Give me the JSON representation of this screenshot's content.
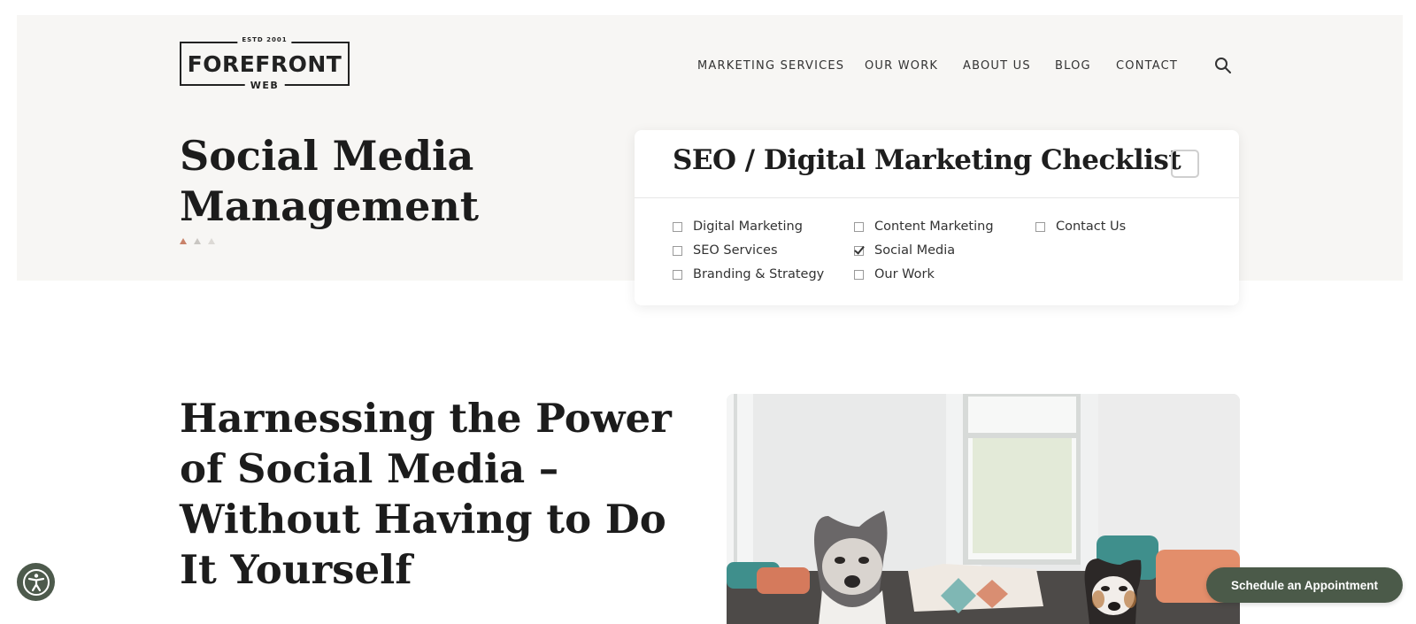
{
  "logo": {
    "tag": "ESTD 2001",
    "name": "FOREFRONT",
    "sub": "WEB"
  },
  "nav": {
    "items": [
      {
        "label": "MARKETING SERVICES"
      },
      {
        "label": "OUR WORK"
      },
      {
        "label": "ABOUT US"
      },
      {
        "label": "BLOG"
      },
      {
        "label": "CONTACT"
      }
    ],
    "search_icon": "search-icon"
  },
  "hero": {
    "title_line1": "Social Media",
    "title_line2": "Management",
    "accent_color": "#c9826a"
  },
  "checklist": {
    "title": "SEO / Digital Marketing Checklist",
    "items": [
      {
        "label": "Digital Marketing",
        "checked": false
      },
      {
        "label": "SEO Services",
        "checked": false
      },
      {
        "label": "Branding & Strategy",
        "checked": false
      },
      {
        "label": "Content Marketing",
        "checked": false
      },
      {
        "label": "Social Media",
        "checked": true
      },
      {
        "label": "Our Work",
        "checked": false
      },
      {
        "label": "Contact Us",
        "checked": false
      }
    ]
  },
  "section": {
    "heading_line1": "Harnessing the Power",
    "heading_line2": "of Social Media –",
    "heading_line3": "Without Having to Do",
    "heading_line4": "It Yourself"
  },
  "floating": {
    "accessibility_icon": "accessibility-icon",
    "schedule_label": "Schedule an Appointment",
    "button_color": "#4b5a49"
  }
}
